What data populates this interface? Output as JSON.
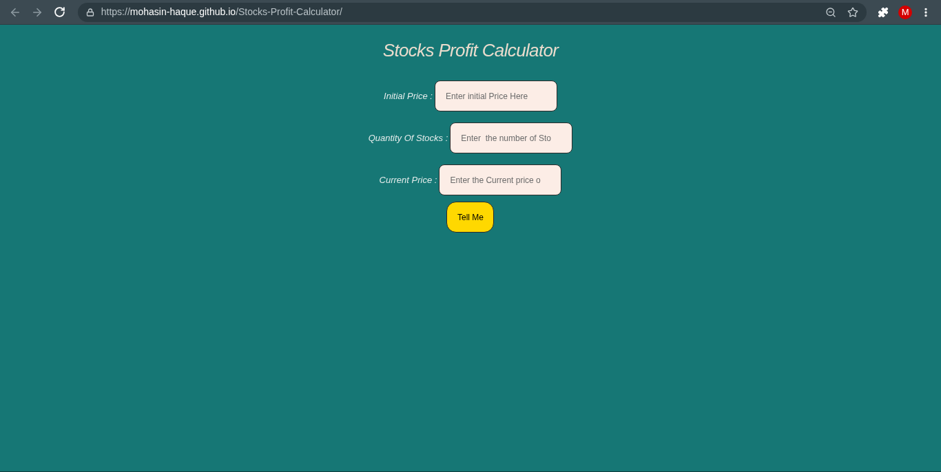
{
  "browser": {
    "url": {
      "scheme": "https://",
      "host": "mohasin-haque.github.io",
      "path": "/Stocks-Profit-Calculator/"
    },
    "profile_initial": "M"
  },
  "page": {
    "title": "Stocks Profit Calculator",
    "fields": [
      {
        "label": "Initial Price :",
        "placeholder": "Enter initial Price Here"
      },
      {
        "label": "Quantity Of Stocks :",
        "placeholder": "Enter  the number of Sto"
      },
      {
        "label": "Current Price :",
        "placeholder": "Enter the Current price o"
      }
    ],
    "button": "Tell Me"
  }
}
